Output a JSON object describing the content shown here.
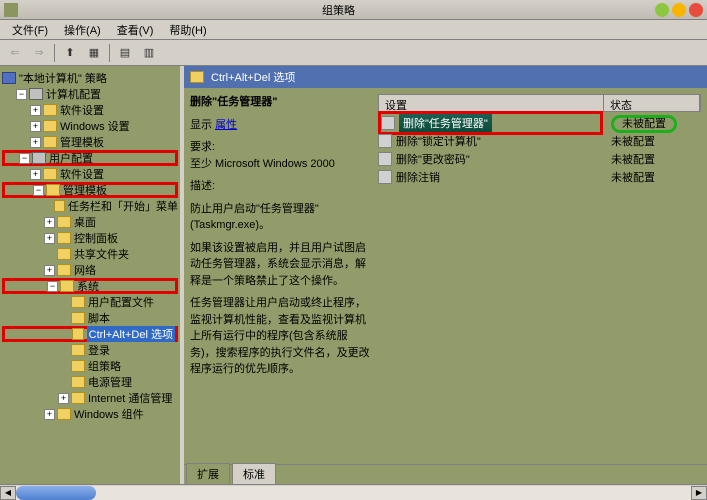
{
  "window_title": "组策略",
  "menubar": {
    "file": "文件(F)",
    "action": "操作(A)",
    "view": "查看(V)",
    "help": "帮助(H)"
  },
  "tree": {
    "root": "\"本地计算机\" 策略",
    "computer_cfg": "计算机配置",
    "software_settings1": "软件设置",
    "windows_settings1": "Windows 设置",
    "admin_templates1": "管理模板",
    "user_cfg": "用户配置",
    "software_settings2": "软件设置",
    "admin_templates2": "管理模板",
    "taskbar": "任务栏和「开始」菜单",
    "desktop": "桌面",
    "control_panel": "控制面板",
    "shared_folders": "共享文件夹",
    "network": "网络",
    "system": "系统",
    "user_profile": "用户配置文件",
    "scripts": "脚本",
    "ctrl_alt_del": "Ctrl+Alt+Del 选项",
    "logon": "登录",
    "gp": "组策略",
    "power_mgmt": "电源管理",
    "internet_mgmt": "Internet 通信管理",
    "windows_comp": "Windows 组件"
  },
  "content": {
    "header": "Ctrl+Alt+Del 选项",
    "selected_policy": "删除\"任务管理器\"",
    "prop_label": "显示",
    "prop_link": "属性",
    "req_label": "要求:",
    "req_text": "至少 Microsoft Windows 2000",
    "desc_label": "描述:",
    "desc_line1": "防止用户启动\"任务管理器\"(Taskmgr.exe)。",
    "desc_line2": "如果该设置被启用，并且用户试图启动任务管理器，系统会显示消息，解释是一个策略禁止了这个操作。",
    "desc_line3": "任务管理器让用户启动或终止程序，监视计算机性能，查看及监视计算机上所有运行中的程序(包含系统服务)，搜索程序的执行文件名，及更改程序运行的优先顺序。"
  },
  "columns": {
    "setting": "设置",
    "state": "状态"
  },
  "list": [
    {
      "name": "删除\"任务管理器\"",
      "state": "未被配置",
      "selected": true,
      "hl_red": true,
      "hl_green": true
    },
    {
      "name": "删除\"锁定计算机\"",
      "state": "未被配置"
    },
    {
      "name": "删除\"更改密码\"",
      "state": "未被配置"
    },
    {
      "name": "删除注销",
      "state": "未被配置"
    }
  ],
  "tabs": {
    "extended": "扩展",
    "standard": "标准"
  }
}
